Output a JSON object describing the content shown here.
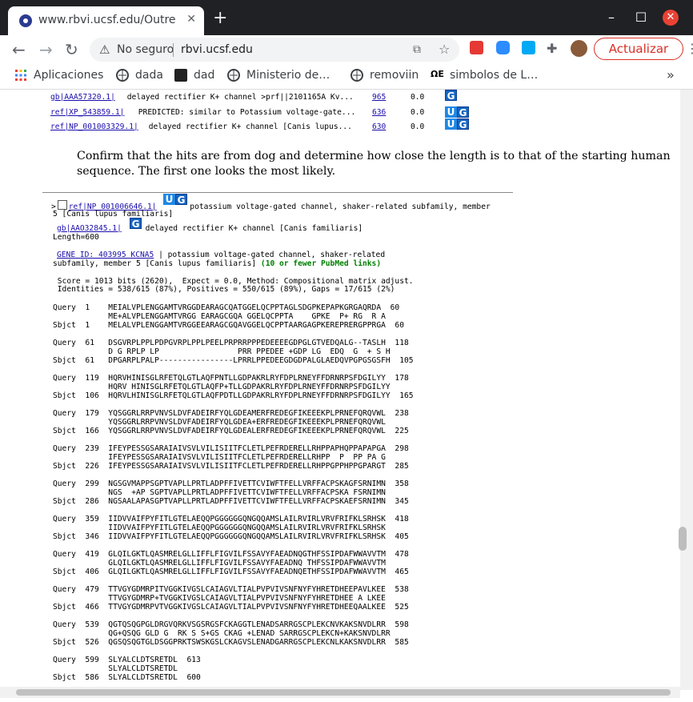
{
  "browser": {
    "tab_title": "www.rbvi.ucsf.edu/Outre",
    "tab_close": "✕",
    "new_tab": "+",
    "security_label": "No seguro",
    "url": "rbvi.ucsf.edu",
    "update_label": "Actualizar",
    "bookmarks": [
      {
        "label": "Aplicaciones",
        "icon": "apps-grid-icon"
      },
      {
        "label": "dada",
        "icon": "globe-icon"
      },
      {
        "label": "dad",
        "icon": "site-icon"
      },
      {
        "label": "Ministerio de…",
        "icon": "globe-icon"
      },
      {
        "label": "removiin",
        "icon": "globe-icon"
      },
      {
        "label": "simbolos de L…",
        "icon": "site-icon"
      }
    ],
    "bookmarks_more": "»"
  },
  "hits": [
    {
      "acc": "gb|AAA57320.1|",
      "desc": " delayed rectifier K+ channel >prf||2101165A Kv...",
      "score": " 965",
      "evalue": "0.0",
      "icons": "G"
    },
    {
      "acc": "ref|XP_543859.1|",
      "desc": " PREDICTED: similar to Potassium voltage-gate...",
      "score": " 636",
      "evalue": "0.0",
      "icons": "UG"
    },
    {
      "acc": "ref|NP_001003329.1|",
      "desc": " delayed rectifier K+ channel [Canis lupus...",
      "score": " 630",
      "evalue": "0.0",
      "icons": "UG"
    }
  ],
  "instruction": "Confirm that the hits are from dog and determine how close the length is to that of the starting human sequence. The first one looks the most likely.",
  "record": {
    "marker": ">",
    "acc1": "ref|NP_001006646.1|",
    "desc1": " potassium voltage-gated channel, shaker-related subfamily, member",
    "desc1b": "5 [Canis lupus familiaris]",
    "acc2": "gb|AAO32845.1|",
    "desc2": " delayed rectifier K+ channel [Canis familiaris]",
    "length": "Length=600",
    "gene_link": "GENE ID: 403995 KCNA5",
    "gene_desc": " | potassium voltage-gated channel, shaker-related",
    "gene_desc2": "subfamily, member 5 [Canis lupus familiaris] ",
    "pubmed": "(10 or fewer PubMed links)",
    "score_line": " Score = 1013 bits (2620),  Expect = 0.0, Method: Compositional matrix adjust.",
    "ident_line": " Identities = 538/615 (87%), Positives = 550/615 (89%), Gaps = 17/615 (2%)"
  },
  "alignment": [
    {
      "q": "Query  1    MEIALVPLENGGAMTVRGGDEARAGCQATGGELQCPPTAGLSDGPKEPAPKGRGAQRDA  60",
      "m": "            ME+ALVPLENGGAMTVRGG EARAGCGQA GGELQCPPTA    GPKE  P+ RG  R A",
      "s": "Sbjct  1    MELALVPLENGGAMTVRGGEEARAGCGQAVGGELQCPPTAARGAGPKEREPRERGPPRGA  60"
    },
    {
      "q": "Query  61   DSGVRPLPPLPDPGVRPLPPLPEELPRPRRPPPEDEEEEGDPGLGTVEDQALG--TASLH  118",
      "m": "            D G RPLP LP                 PRR PPEDEE +GDP LG  EDQ  G  + S H",
      "s": "Sbjct  61   DPGARPLPALP----------------LPRRLPPEDEEGDGDPALGLAEDQVPGPGSGSFH  105"
    },
    {
      "q": "Query  119  HQRVHINISGLRFETQLGTLAQFPNTLLGDPAKRLRYFDPLRNEYFFDRNRPSFDGILYY  178",
      "m": "            HQRV HINISGLRFETQLGTLAQFP+TLLGDPAKRLRYFDPLRNEYFFDRNRPSFDGILYY",
      "s": "Sbjct  106  HQRVLHINISGLRFETQLGTLAQFPDTLLGDPAKRLRYFDPLRNEYFFDRNRPSFDGILYY  165"
    },
    {
      "q": "Query  179  YQSGGRLRRPVNVSLDVFADEIRFYQLGDEAMERFREDEGFIKEEEKPLPRNEFQRQVWL  238",
      "m": "            YQSGGRLRRPVNVSLDVFADEIRFYQLGDEA+ERFREDEGFIKEEEKPLPRNEFQRQVWL",
      "s": "Sbjct  166  YQSGGRLRRPVNVSLDVFADEIRFYQLGDEALERFREDEGFIKEEEKPLPRNEFQRQVWL  225"
    },
    {
      "q": "Query  239  IFEYPESSGSARAIAIVSVLVILISIITFCLETLPEFRDERELLRHPPAPHQPPAPAPGA  298",
      "m": "            IFEYPESSGSARAIAIVSVLVILISIITFCLETLPEFRDERELLRHPP  P  PP PA G",
      "s": "Sbjct  226  IFEYPESSGSARAIAIVSVLVILISIITFCLETLPEFRDERELLRHPPGPPHPPGPARGT  285"
    },
    {
      "q": "Query  299  NGSGVMAPPSGPTVAPLLPRTLADPFFIVETTCVIWFTFELLVRFFACPSKAGFSRNIMN  358",
      "m": "            NGS  +AP SGPTVAPLLPRTLADPFFIVETTCVIWFTFELLVRFFACPSKA FSRNIMN",
      "s": "Sbjct  286  NGSAALAPASGPTVAPLLPRTLADPFFIVETTCVIWFTFELLVRFFACPSKAEFSRNIMN  345"
    },
    {
      "q": "Query  359  IIDVVAIFPYFITLGTELAEQQPGGGGGGQNGQQAMSLAILRVIRLVRVFRIFKLSRHSK  418",
      "m": "            IIDVVAIFPYFITLGTELAEQQPGGGGGGQNGQQAMSLAILRVIRLVRVFRIFKLSRHSK",
      "s": "Sbjct  346  IIDVVAIFPYFITLGTELAEQQPGGGGGGQNGQQAMSLAILRVIRLVRVFRIFKLSRHSK  405"
    },
    {
      "q": "Query  419  GLQILGKTLQASMRELGLLIFFLFIGVILFSSAVYFAEADNQGTHFSSIPDAFWWAVVTM  478",
      "m": "            GLQILGKTLQASMRELGLLIFFLFIGVILFSSAVYFAEADNQ THFSSIPDAFWWAVVTM",
      "s": "Sbjct  406  GLQILGKTLQASMRELGLLIFFLFIGVILFSSAVYFAEADNQETHFSSIPDAFWWAVVTM  465"
    },
    {
      "q": "Query  479  TTVGYGDMRPITVGGKIVGSLCAIAGVLTIALPVPVIVSNFNYFYHRETDHEEPAVLKEE  538",
      "m": "            TTVGYGDMRP+TVGGKIVGSLCAIAGVLTIALPVPVIVSNFNYFYHRETDHEE A LKEE",
      "s": "Sbjct  466  TTVGYGDMRPVTVGGKIVGSLCAIAGVLTIALPVPVIVSNFNYFYHRETDHEEQAALKEE  525"
    },
    {
      "q": "Query  539  QGTQSQGPGLDRGVQRKVSGSRGSFCKAGGTLENADSARRGSCPLEKCNVKAKSNVDLRR  598",
      "m": "            QG+QSQG GLD G  RK S S+GS CKAG +LENAD SARRGSCPLEKCN+KAKSNVDLRR",
      "s": "Sbjct  526  QGSQSQGTGLDSGGPRKTSWSKGSLCKAGVSLENADGARRGSCPLEKCNLKAKSNVDLRR  585"
    },
    {
      "q": "Query  599  SLYALCLDTSRETDL  613",
      "m": "            SLYALCLDTSRETDL",
      "s": "Sbjct  586  SLYALCLDTSRETDL  600"
    }
  ]
}
